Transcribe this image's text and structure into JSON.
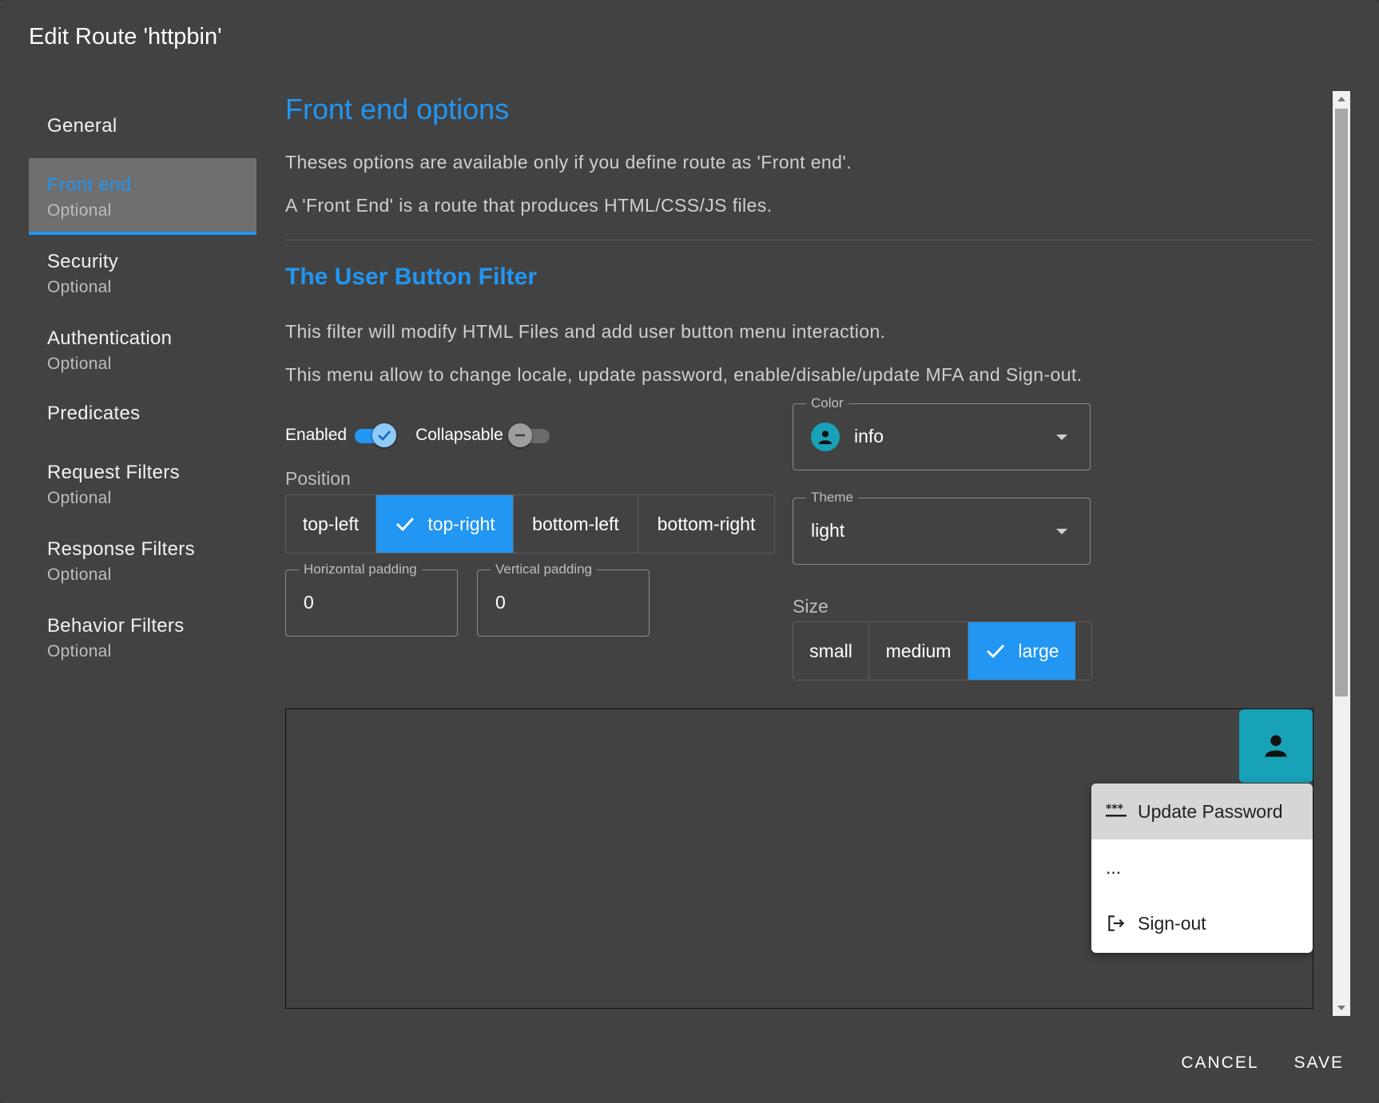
{
  "dialog": {
    "title": "Edit Route 'httpbin'"
  },
  "sidebar": {
    "items": [
      {
        "label": "General",
        "sub": ""
      },
      {
        "label": "Front end",
        "sub": "Optional"
      },
      {
        "label": "Security",
        "sub": "Optional"
      },
      {
        "label": "Authentication",
        "sub": "Optional"
      },
      {
        "label": "Predicates",
        "sub": ""
      },
      {
        "label": "Request Filters",
        "sub": "Optional"
      },
      {
        "label": "Response Filters",
        "sub": "Optional"
      },
      {
        "label": "Behavior Filters",
        "sub": "Optional"
      }
    ],
    "active_index": 1
  },
  "main": {
    "title": "Front end options",
    "intro_1": "Theses options are available only if you define route as 'Front end'.",
    "intro_2": "A 'Front End' is a route that produces HTML/CSS/JS files.",
    "section_title": "The User Button Filter",
    "desc_1": "This filter will modify HTML Files and add user button menu interaction.",
    "desc_2": "This menu allow to change locale, update password, enable/disable/update MFA and Sign-out.",
    "enabled": {
      "label": "Enabled",
      "checked": true
    },
    "collapsable": {
      "label": "Collapsable",
      "checked": false
    },
    "position": {
      "label": "Position",
      "options": [
        "top-left",
        "top-right",
        "bottom-left",
        "bottom-right"
      ],
      "selected": "top-right"
    },
    "horizontal_padding": {
      "label": "Horizontal padding",
      "value": "0"
    },
    "vertical_padding": {
      "label": "Vertical padding",
      "value": "0"
    },
    "color": {
      "label": "Color",
      "value": "info",
      "swatch": "#17a2b8"
    },
    "theme": {
      "label": "Theme",
      "value": "light"
    },
    "size": {
      "label": "Size",
      "options": [
        "small",
        "medium",
        "large"
      ],
      "selected": "large"
    },
    "preview": {
      "menu_items": [
        {
          "icon": "password-icon",
          "label": "Update Password"
        },
        {
          "icon": "",
          "label": "..."
        },
        {
          "icon": "logout-icon",
          "label": "Sign-out"
        }
      ]
    }
  },
  "actions": {
    "cancel": "CANCEL",
    "save": "SAVE"
  },
  "colors": {
    "accent": "#2196f3",
    "surface": "#424242",
    "info": "#17a2b8"
  }
}
